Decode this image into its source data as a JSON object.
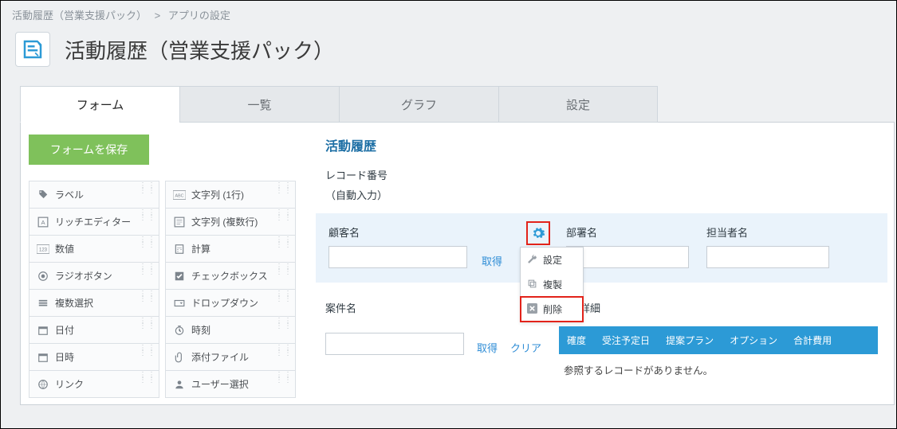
{
  "crumb": {
    "a": "活動履歴（営業支援パック）",
    "sep": ">",
    "b": "アプリの設定"
  },
  "title": "活動履歴（営業支援パック）",
  "tabs": [
    "フォーム",
    "一覧",
    "グラフ",
    "設定"
  ],
  "save": "フォームを保存",
  "palette": {
    "left": [
      "ラベル",
      "リッチエディター",
      "数値",
      "ラジオボタン",
      "複数選択",
      "日付",
      "日時",
      "リンク"
    ],
    "right": [
      "文字列 (1行)",
      "文字列 (複数行)",
      "計算",
      "チェックボックス",
      "ドロップダウン",
      "時刻",
      "添付ファイル",
      "ユーザー選択"
    ]
  },
  "preview": {
    "section": "活動履歴",
    "recnum": "レコード番号",
    "auto": "（自動入力）",
    "customer": "顧客名",
    "dept": "部署名",
    "person": "担当者名",
    "get": "取得",
    "clear": "クリア",
    "case": "案件名",
    "caseDetail": "案件詳細",
    "cols": [
      "確度",
      "受注予定日",
      "提案プラン",
      "オプション",
      "合計費用"
    ],
    "empty": "参照するレコードがありません。"
  },
  "menu": {
    "settings": "設定",
    "copy": "複製",
    "del": "削除"
  }
}
